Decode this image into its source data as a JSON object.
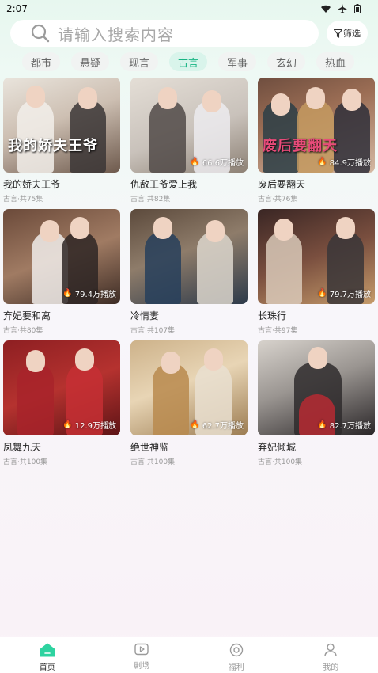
{
  "status": {
    "time": "2:07",
    "icons": [
      "wifi-icon",
      "airplane-icon",
      "battery-icon"
    ]
  },
  "search": {
    "placeholder": "请输入搜索内容",
    "filter_label": "筛选"
  },
  "categories": [
    "都市",
    "悬疑",
    "现言",
    "古言",
    "军事",
    "玄幻",
    "热血"
  ],
  "active_category": "古言",
  "dramas": [
    {
      "title": "我的娇夫王爷",
      "meta": "古言·共75集",
      "plays": "",
      "poster_text": "我的娇夫王爷"
    },
    {
      "title": "仇敌王爷爱上我",
      "meta": "古言·共82集",
      "plays": "66.6万播放",
      "poster_text": ""
    },
    {
      "title": "废后要翻天",
      "meta": "古言·共76集",
      "plays": "84.9万播放",
      "poster_text": "废后要翻天"
    },
    {
      "title": "弃妃要和离",
      "meta": "古言·共80集",
      "plays": "79.4万播放",
      "poster_text": ""
    },
    {
      "title": "冷情妻",
      "meta": "古言·共107集",
      "plays": "",
      "poster_text": ""
    },
    {
      "title": "长珠行",
      "meta": "古言·共97集",
      "plays": "79.7万播放",
      "poster_text": ""
    },
    {
      "title": "凤舞九天",
      "meta": "古言·共100集",
      "plays": "12.9万播放",
      "poster_text": ""
    },
    {
      "title": "绝世神监",
      "meta": "古言·共100集",
      "plays": "62.7万播放",
      "poster_text": ""
    },
    {
      "title": "弃妃倾城",
      "meta": "古言·共100集",
      "plays": "82.7万播放",
      "poster_text": ""
    }
  ],
  "tabbar": [
    {
      "label": "首页",
      "icon": "home-icon",
      "active": true
    },
    {
      "label": "剧场",
      "icon": "theater-icon",
      "active": false
    },
    {
      "label": "福利",
      "icon": "welfare-icon",
      "active": false
    },
    {
      "label": "我的",
      "icon": "profile-icon",
      "active": false
    }
  ],
  "colors": {
    "accent": "#17b483",
    "active_chip_bg": "#d9f4eb"
  }
}
